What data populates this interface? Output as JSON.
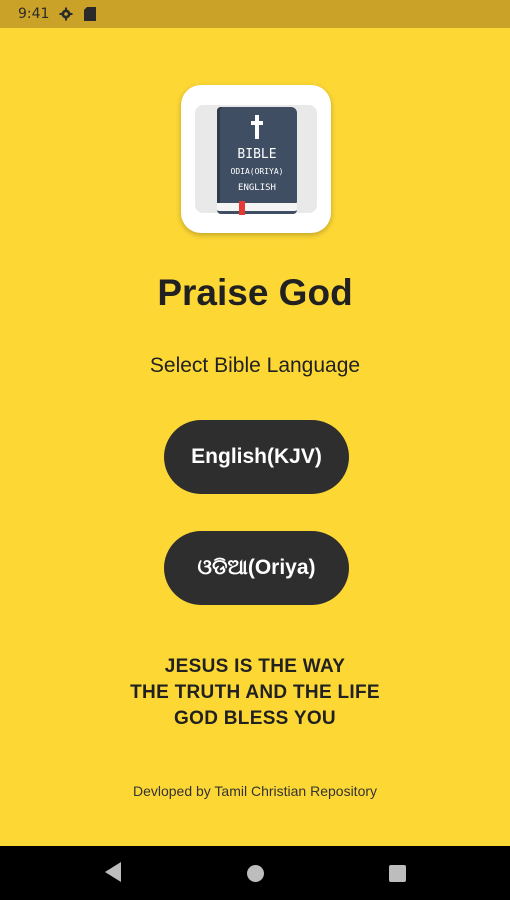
{
  "status_bar": {
    "time": "9:41",
    "icons": [
      "settings-icon",
      "sim-card-icon"
    ]
  },
  "app_icon": {
    "name": "bible-book-icon",
    "line1": "BIBLE",
    "line2": "ODIA(ORIYA)",
    "line3": "ENGLISH"
  },
  "main": {
    "title": "Praise God",
    "subtitle": "Select Bible Language",
    "buttons": [
      {
        "label": "English(KJV)"
      },
      {
        "label": "ଓଡିଆ(Oriya)"
      }
    ],
    "verse_lines": [
      "JESUS IS THE WAY",
      "THE TRUTH AND THE LIFE",
      "GOD BLESS YOU"
    ],
    "footer": "Devloped by Tamil Christian Repository"
  },
  "nav_bar": {
    "icons": [
      "back-icon",
      "home-icon",
      "recent-apps-icon"
    ]
  },
  "colors": {
    "background": "#FDD835",
    "status_bar": "#C9A227",
    "button": "#2E2E2E",
    "text": "#212121"
  }
}
